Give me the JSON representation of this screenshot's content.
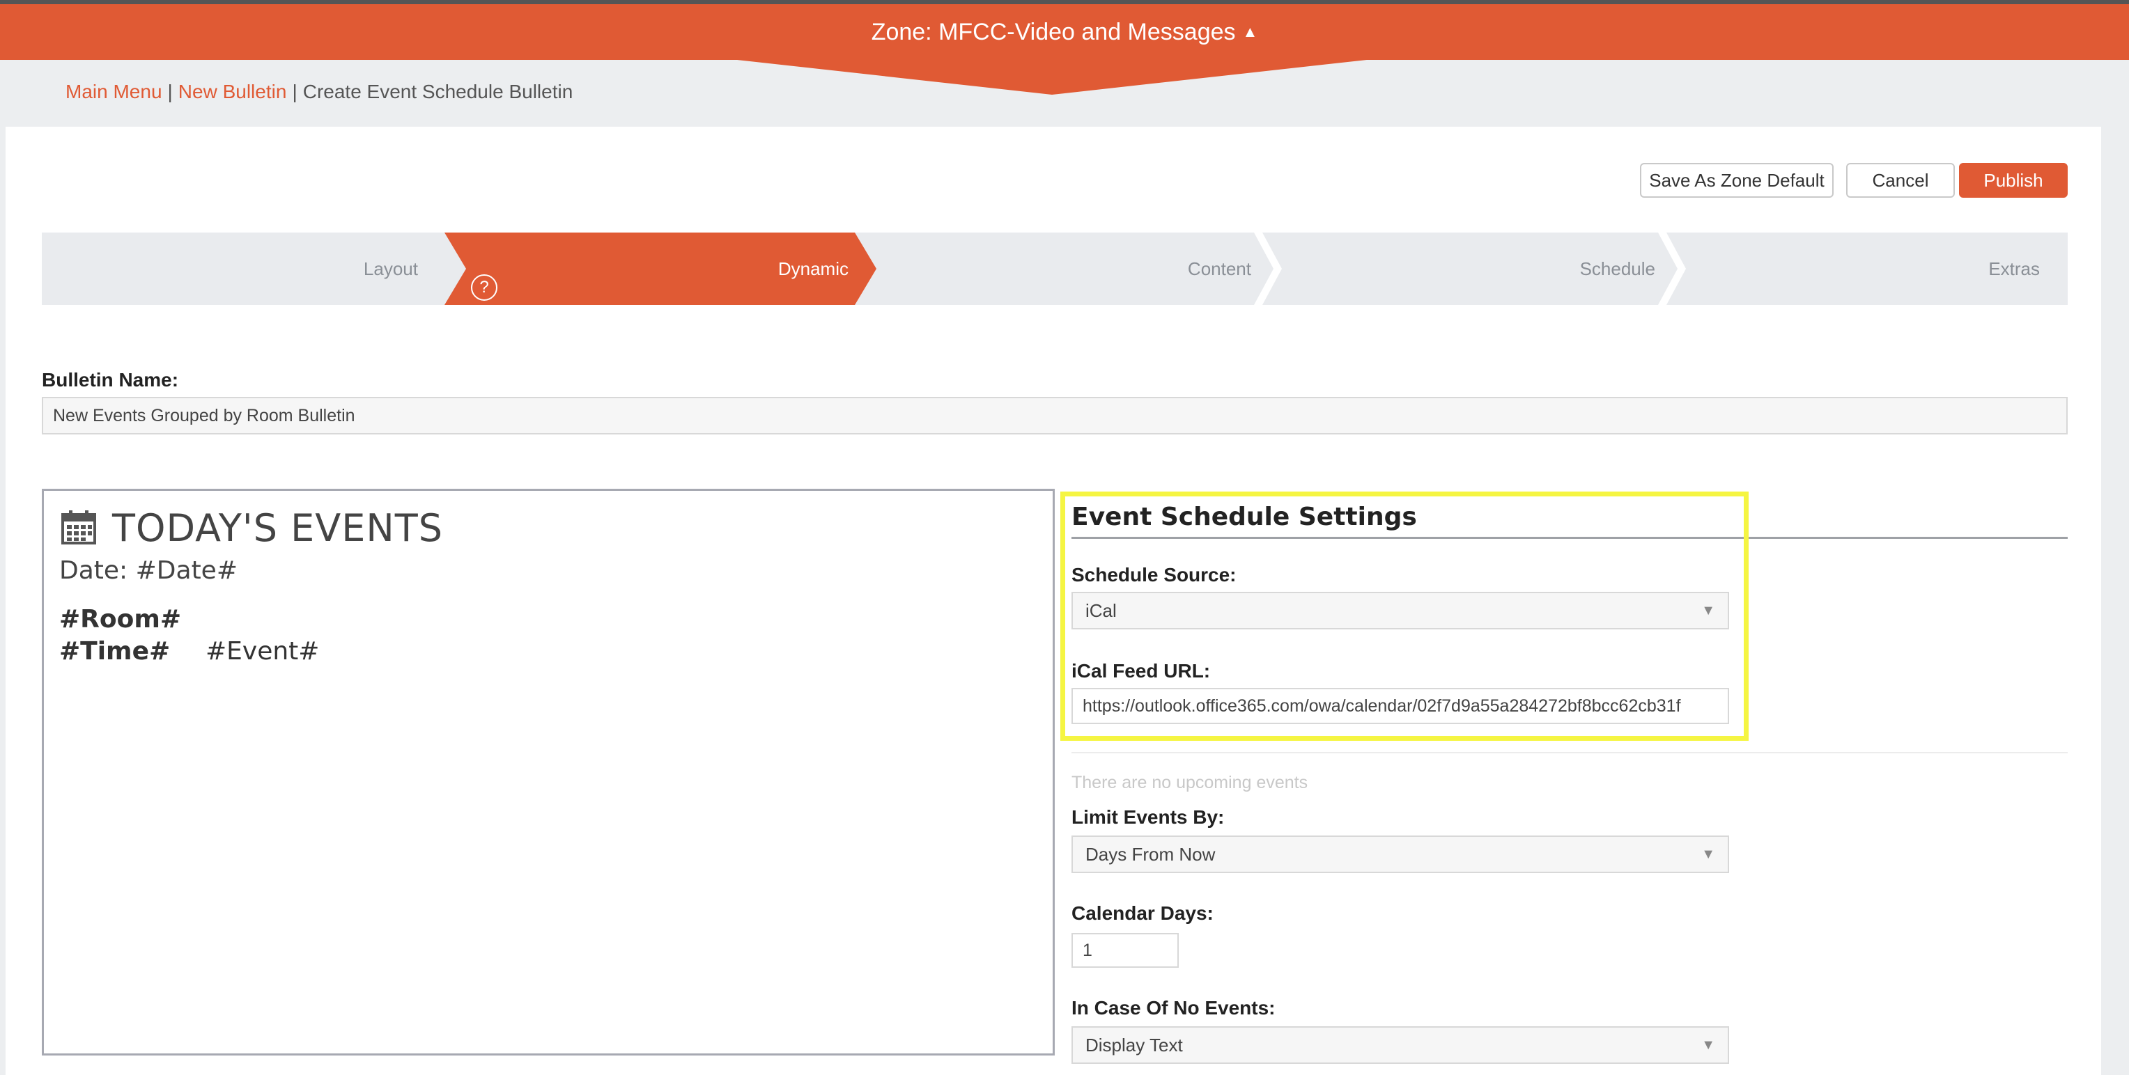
{
  "zone": {
    "title": "Zone: MFCC-Video and Messages",
    "caret_icon": "caret-up-icon"
  },
  "breadcrumb": {
    "main_menu": "Main Menu",
    "new_bulletin": "New Bulletin",
    "current": "Create Event Schedule Bulletin",
    "separator": "|"
  },
  "toolbar": {
    "save_default": "Save As Zone Default",
    "cancel": "Cancel",
    "publish": "Publish"
  },
  "steps": [
    {
      "label": "Layout",
      "active": false
    },
    {
      "label": "Dynamic",
      "active": true
    },
    {
      "label": "Content",
      "active": false
    },
    {
      "label": "Schedule",
      "active": false
    },
    {
      "label": "Extras",
      "active": false
    }
  ],
  "help": {
    "glyph": "?"
  },
  "bulletin": {
    "name_label": "Bulletin Name:",
    "name_value": "New Events Grouped by Room Bulletin"
  },
  "preview": {
    "icon": "calendar-icon",
    "title": "TODAY'S EVENTS",
    "date": "Date: #Date#",
    "room": "#Room#",
    "time": "#Time#",
    "event": "#Event#"
  },
  "settings": {
    "title": "Event Schedule Settings",
    "source_label": "Schedule Source:",
    "source_value": "iCal",
    "feed_label": "iCal Feed URL:",
    "feed_value": "https://outlook.office365.com/owa/calendar/02f7d9a55a284272bf8bcc62cb31f",
    "no_events_msg": "There are no upcoming events",
    "limit_label": "Limit Events By:",
    "limit_value": "Days From Now",
    "days_label": "Calendar Days:",
    "days_value": "1",
    "none_label": "In Case Of No Events:",
    "none_value": "Display Text"
  },
  "colors": {
    "accent": "#e05a34",
    "highlight": "#f5f542",
    "step_bg": "#e9ebee"
  }
}
